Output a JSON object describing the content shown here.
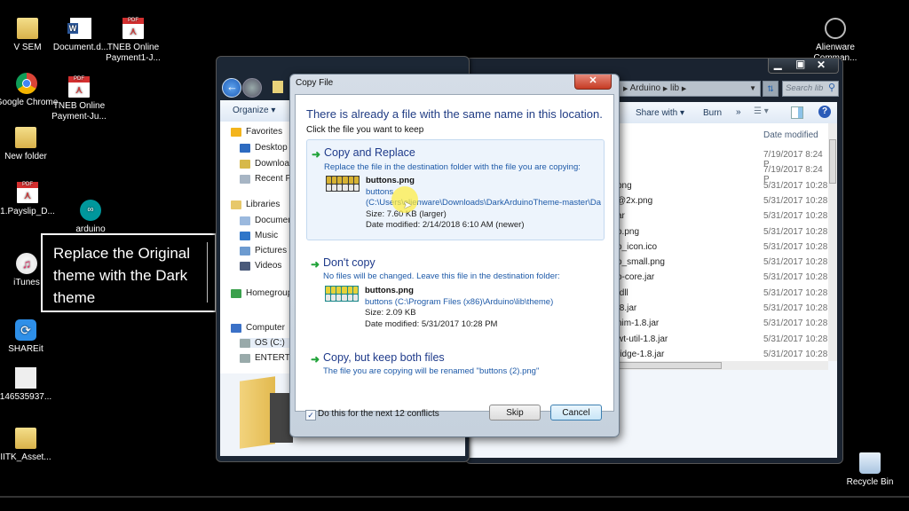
{
  "desktop": {
    "icons": [
      {
        "label": "V SEM",
        "icon": "folder-icon"
      },
      {
        "label": "Document.d...",
        "icon": "word-doc-icon"
      },
      {
        "label": "TNEB Online Payment1-J...",
        "icon": "pdf-icon"
      },
      {
        "label": "Google Chrome",
        "icon": "chrome-icon"
      },
      {
        "label": "TNEB Online Payment-Ju...",
        "icon": "pdf-icon"
      },
      {
        "label": "New folder",
        "icon": "folder-icon"
      },
      {
        "label": "1.Payslip_D...",
        "icon": "pdf-icon"
      },
      {
        "label": "arduino",
        "icon": "arduino-icon"
      },
      {
        "label": "iTunes",
        "icon": "itunes-icon"
      },
      {
        "label": "SHAREit",
        "icon": "shareit-icon"
      },
      {
        "label": "146535937...",
        "icon": "image-file-icon"
      },
      {
        "label": "IITK_Asset...",
        "icon": "zip-folder-icon"
      },
      {
        "label": "Alienware Comman...",
        "icon": "alienware-icon"
      },
      {
        "label": "Recycle Bin",
        "icon": "recycle-bin-icon"
      }
    ]
  },
  "annotation": {
    "text": "Replace the Original theme with the Dark theme"
  },
  "explorer_left": {
    "organize_label": "Organize ▾",
    "nav": [
      {
        "label": "Favorites",
        "icon": "star-icon"
      },
      {
        "label": "Desktop",
        "icon": "desktop-icon"
      },
      {
        "label": "Downloads",
        "icon": "downloads-icon"
      },
      {
        "label": "Recent Places",
        "icon": "recent-places-icon"
      },
      {
        "label": "Libraries",
        "icon": "libraries-icon"
      },
      {
        "label": "Documents",
        "icon": "documents-icon"
      },
      {
        "label": "Music",
        "icon": "music-icon"
      },
      {
        "label": "Pictures",
        "icon": "pictures-icon"
      },
      {
        "label": "Videos",
        "icon": "videos-icon"
      },
      {
        "label": "Homegroup",
        "icon": "homegroup-icon"
      },
      {
        "label": "Computer",
        "icon": "computer-icon"
      },
      {
        "label": "OS (C:)",
        "icon": "drive-icon"
      },
      {
        "label": "ENTERTAINMENT",
        "icon": "drive-icon"
      }
    ]
  },
  "explorer_right": {
    "breadcrumb": [
      "Arduino",
      "lib"
    ],
    "search_placeholder": "Search lib",
    "toolbar": {
      "share_with": "Share with ▾",
      "burn": "Burn",
      "more": "»"
    },
    "column_header": "Date modified",
    "files": [
      {
        "name": "",
        "date": "7/19/2017 8:24 P"
      },
      {
        "name": "",
        "date": "7/19/2017 8:24 P"
      },
      {
        "name": "png",
        "date": "5/31/2017 10:28"
      },
      {
        "name": "@2x.png",
        "date": "5/31/2017 10:28"
      },
      {
        "name": "ar",
        "date": "5/31/2017 10:28"
      },
      {
        "name": "o.png",
        "date": "5/31/2017 10:28"
      },
      {
        "name": "o_icon.ico",
        "date": "5/31/2017 10:28"
      },
      {
        "name": "o_small.png",
        "date": "5/31/2017 10:28"
      },
      {
        "name": "o-core.jar",
        "date": "5/31/2017 10:28"
      },
      {
        "name": ".dll",
        "date": "5/31/2017 10:28"
      },
      {
        "name": ".8.jar",
        "date": "5/31/2017 10:28"
      },
      {
        "name": "nim-1.8.jar",
        "date": "5/31/2017 10:28"
      },
      {
        "name": "wt-util-1.8.jar",
        "date": "5/31/2017 10:28"
      },
      {
        "name": "ridge-1.8.jar",
        "date": "5/31/2017 10:28"
      }
    ]
  },
  "dialog": {
    "title": "Copy File",
    "close": "✕",
    "heading": "There is already a file with the same name in this location.",
    "subheading": "Click the file you want to keep",
    "options": [
      {
        "title": "Copy and Replace",
        "desc": "Replace the file in the destination folder with the file you are copying:",
        "file_name": "buttons.png",
        "file_link1": "buttons",
        "file_link2": "(C:\\Users\\alienware\\Downloads\\DarkArduinoTheme-master\\Da",
        "size": "Size: 7.60 KB (larger)",
        "date": "Date modified: 2/14/2018 6:10 AM (newer)"
      },
      {
        "title": "Don't copy",
        "desc": "No files will be changed. Leave this file in the destination folder:",
        "file_name": "buttons.png",
        "file_link1": "buttons (C:\\Program Files (x86)\\Arduino\\lib\\theme)",
        "size": "Size: 2.09 KB",
        "date": "Date modified: 5/31/2017 10:28 PM"
      },
      {
        "title": "Copy, but keep both files",
        "desc": "The file you are copying will be renamed \"buttons (2).png\""
      }
    ],
    "checkbox_label": "Do this for the next 12 conflicts",
    "checkbox_checked": true,
    "skip": "Skip",
    "cancel": "Cancel"
  }
}
